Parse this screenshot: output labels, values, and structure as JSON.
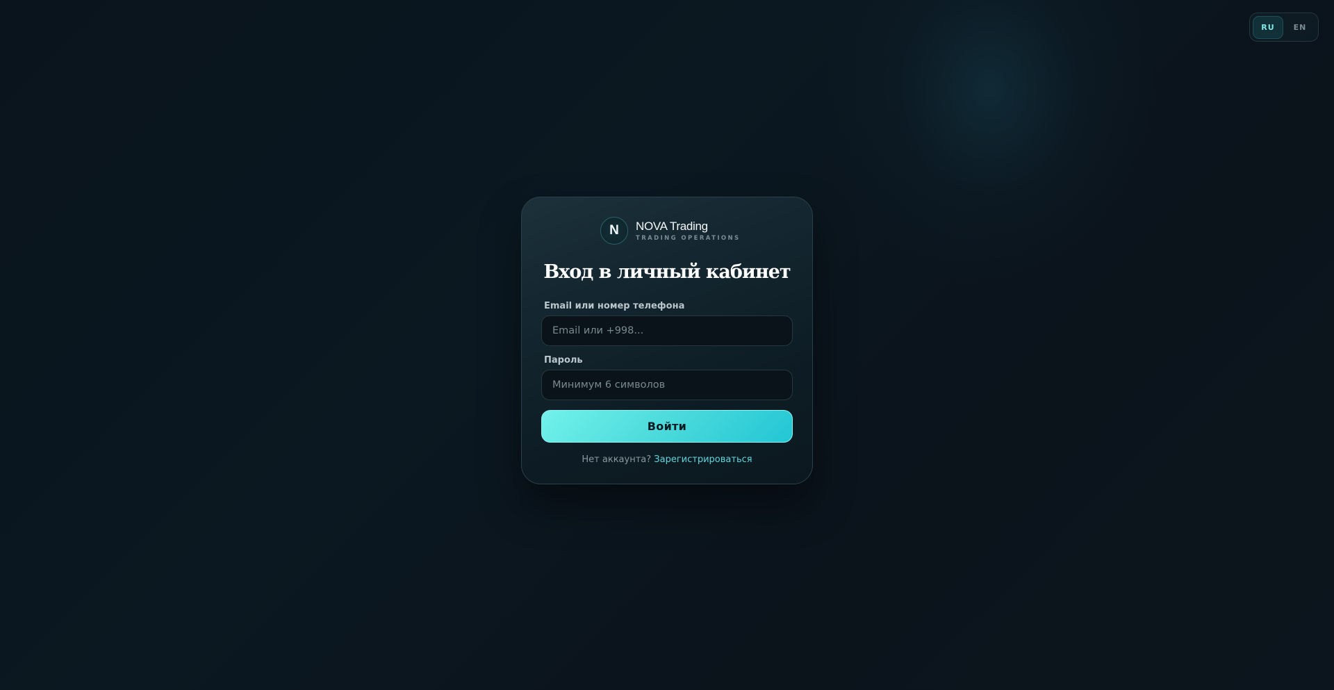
{
  "lang": {
    "options": [
      {
        "code": "RU",
        "active": true
      },
      {
        "code": "EN",
        "active": false
      }
    ]
  },
  "brand": {
    "logo_letter": "N",
    "name": "NOVA Trading",
    "tagline": "TRADING OPERATIONS"
  },
  "login": {
    "title": "Вход в личный кабинет",
    "login_field": {
      "label": "Email или номер телефона",
      "value": "",
      "placeholder": "Email или +998..."
    },
    "password_field": {
      "label": "Пароль",
      "value": "",
      "placeholder": "Минимум 6 символов"
    },
    "submit_label": "Войти",
    "no_account_text": "Нет аккаунта?",
    "register_link": "Зарегистрироваться"
  },
  "colors": {
    "accent": "#4fdcdc",
    "accent_link": "#5fd6dc",
    "background": "#0b161e",
    "card": "#13252e"
  }
}
